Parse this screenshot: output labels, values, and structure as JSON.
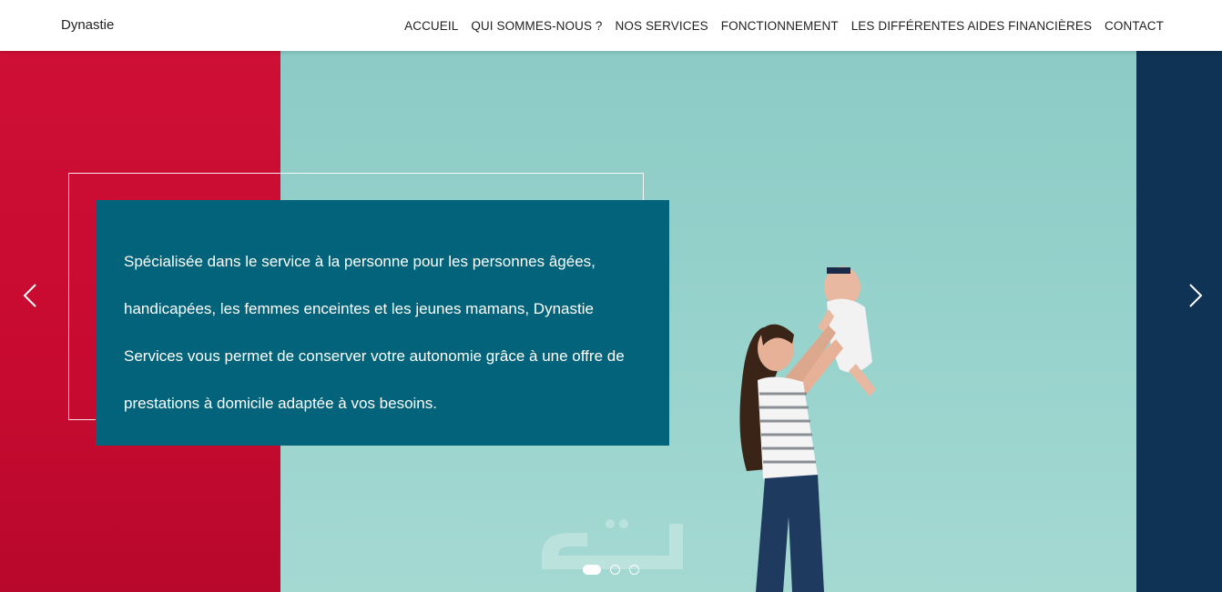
{
  "navbar": {
    "brand": "Dynastie",
    "links": [
      {
        "label": "ACCUEIL"
      },
      {
        "label": "QUI SOMMES-NOUS ?"
      },
      {
        "label": "NOS SERVICES"
      },
      {
        "label": "FONCTIONNEMENT"
      },
      {
        "label": "LES DIFFÉRENTES AIDES FINANCIÈRES"
      },
      {
        "label": "CONTACT"
      }
    ]
  },
  "hero": {
    "caption": "Spécialisée dans le service à la personne pour les personnes âgées, handicapées, les femmes enceintes et les jeunes mamans, Dynastie Services vous permet de conserver votre autonomie grâce à une offre de prestations à domicile adaptée à vos besoins.",
    "prev_icon": "chevron-left-icon",
    "next_icon": "chevron-right-icon",
    "slides_count": 3,
    "active_slide": 1
  },
  "colors": {
    "red": "#cf0f35",
    "teal": "#97d2cc",
    "navy": "#0f3354",
    "caption_bg": "#03637a"
  }
}
